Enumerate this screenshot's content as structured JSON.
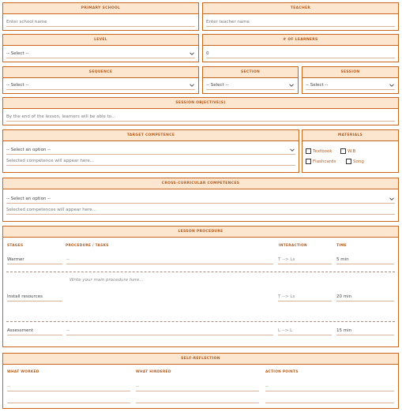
{
  "school": {
    "label": "PRIMARY SCHOOL",
    "placeholder": "Enter school name"
  },
  "teacher": {
    "label": "TEACHER",
    "placeholder": "Enter teacher name"
  },
  "level": {
    "label": "LEVEL",
    "value": "-- Select --"
  },
  "learners": {
    "label": "# OF LEARNERS",
    "value": "0"
  },
  "sequence": {
    "label": "SEQUENCE",
    "value": "-- Select --"
  },
  "section": {
    "label": "SECTION",
    "value": "-- Select --"
  },
  "session": {
    "label": "SESSION",
    "value": "-- Select --"
  },
  "objectives": {
    "label": "SESSION OBJECTIVE(S)",
    "placeholder": "By the end of the lesson, learners will be able to..."
  },
  "target": {
    "label": "TARGET COMPETENCE",
    "select": "-- Select an option --",
    "hint": "Selected competence will appear here..."
  },
  "materials": {
    "label": "MATERIALS",
    "items": [
      {
        "label": "Textbook",
        "checked": false
      },
      {
        "label": "W.B",
        "checked": false
      },
      {
        "label": "Flashcards",
        "checked": false
      },
      {
        "label": "Song",
        "checked": false
      }
    ]
  },
  "cross": {
    "label": "CROSS-CURRICULAR COMPETENCES",
    "select": "-- Select an option --",
    "hint": "Selected competences will appear here..."
  },
  "procedure": {
    "label": "LESSON PROCEDURE",
    "columns": [
      "STAGES",
      "PROCEDURE / TASKS",
      "INTERACTION",
      "TIME"
    ],
    "rows": [
      {
        "stage": "Warmer",
        "task": "--",
        "interaction": "T --> Ls",
        "time": "5 min"
      },
      {
        "stage": "Install resources",
        "task": "",
        "interaction": "T --> Ls",
        "time": "20 min"
      },
      {
        "stage": "Assessment",
        "task": "--",
        "interaction": "L --> L",
        "time": "15 min"
      }
    ],
    "main_placeholder": "Write your main procedure here..."
  },
  "reflection": {
    "label": "SELF-REFLECTION",
    "columns": [
      "WHAT WORKED",
      "WHAT HINDERED",
      "ACTION POINTS"
    ],
    "values": [
      "--",
      "--",
      "--"
    ]
  },
  "accent_color": "#c8651b",
  "header_bg": "#fde6cf"
}
